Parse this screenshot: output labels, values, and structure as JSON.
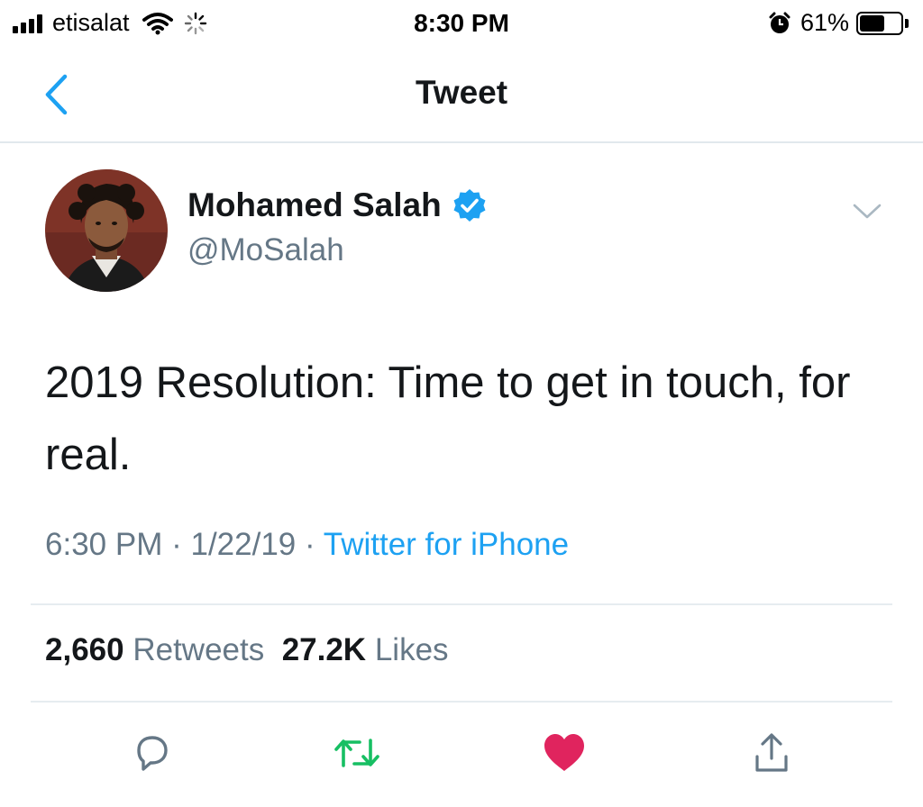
{
  "status_bar": {
    "carrier": "etisalat",
    "time": "8:30 PM",
    "battery_percent": "61%",
    "battery_level": 0.61,
    "icons": [
      "signal-bars-icon",
      "wifi-icon",
      "loading-spinner-icon",
      "alarm-icon",
      "battery-icon"
    ]
  },
  "nav": {
    "title": "Tweet",
    "back_icon": "chevron-left-icon"
  },
  "tweet": {
    "author_name": "Mohamed Salah",
    "handle": "@MoSalah",
    "verified": true,
    "text": "2019 Resolution: Time to get in touch, for real.",
    "time": "6:30 PM",
    "date": "1/22/19",
    "separator": "·",
    "source": "Twitter for iPhone",
    "retweet_count": "2,660",
    "retweet_label": "Retweets",
    "like_count": "27.2K",
    "like_label": "Likes"
  },
  "actions": [
    "reply-icon",
    "retweet-icon",
    "like-icon",
    "share-icon"
  ],
  "colors": {
    "accent": "#1da1f2",
    "retweet": "#17bf63",
    "like": "#e0245e",
    "secondary_text": "#657786",
    "primary_text": "#14171a"
  }
}
